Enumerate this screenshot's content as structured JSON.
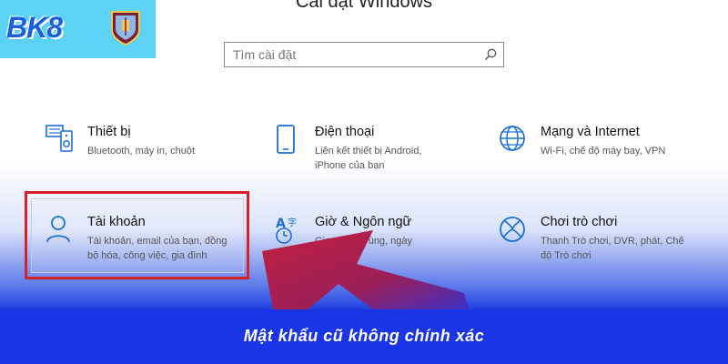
{
  "window": {
    "title": "Cài đặt Windows"
  },
  "search": {
    "placeholder": "Tìm cài đặt"
  },
  "tiles": [
    {
      "title": "Thiết bị",
      "desc": "Bluetooth, máy in, chuột",
      "icon": "devices-icon"
    },
    {
      "title": "Điện thoại",
      "desc": "Liên kết thiết bị Android, iPhone của bạn",
      "icon": "phone-icon"
    },
    {
      "title": "Mạng và Internet",
      "desc": "Wi-Fi, chế độ máy bay, VPN",
      "icon": "globe-icon"
    },
    {
      "title": "Tài khoản",
      "desc": "Tài khoản, email của bạn, đồng bộ hóa, công việc, gia đình",
      "icon": "person-icon"
    },
    {
      "title": "Giờ & Ngôn ngữ",
      "desc": "Giọng nói, vùng, ngày",
      "icon": "time-language-icon"
    },
    {
      "title": "Chơi trò chơi",
      "desc": "Thanh Trò chơi, DVR, phát, Chế độ Trò chơi",
      "icon": "xbox-icon"
    }
  ],
  "branding": {
    "logo_text": "BK8",
    "crest": "club-crest-icon"
  },
  "caption": {
    "text": "Mật khẩu cũ không chính xác"
  },
  "colors": {
    "accent_blue": "#1a35e6",
    "highlight_red": "#d8202a",
    "icon_blue": "#1a6fd6",
    "logo_bg": "#5cd2f5"
  }
}
